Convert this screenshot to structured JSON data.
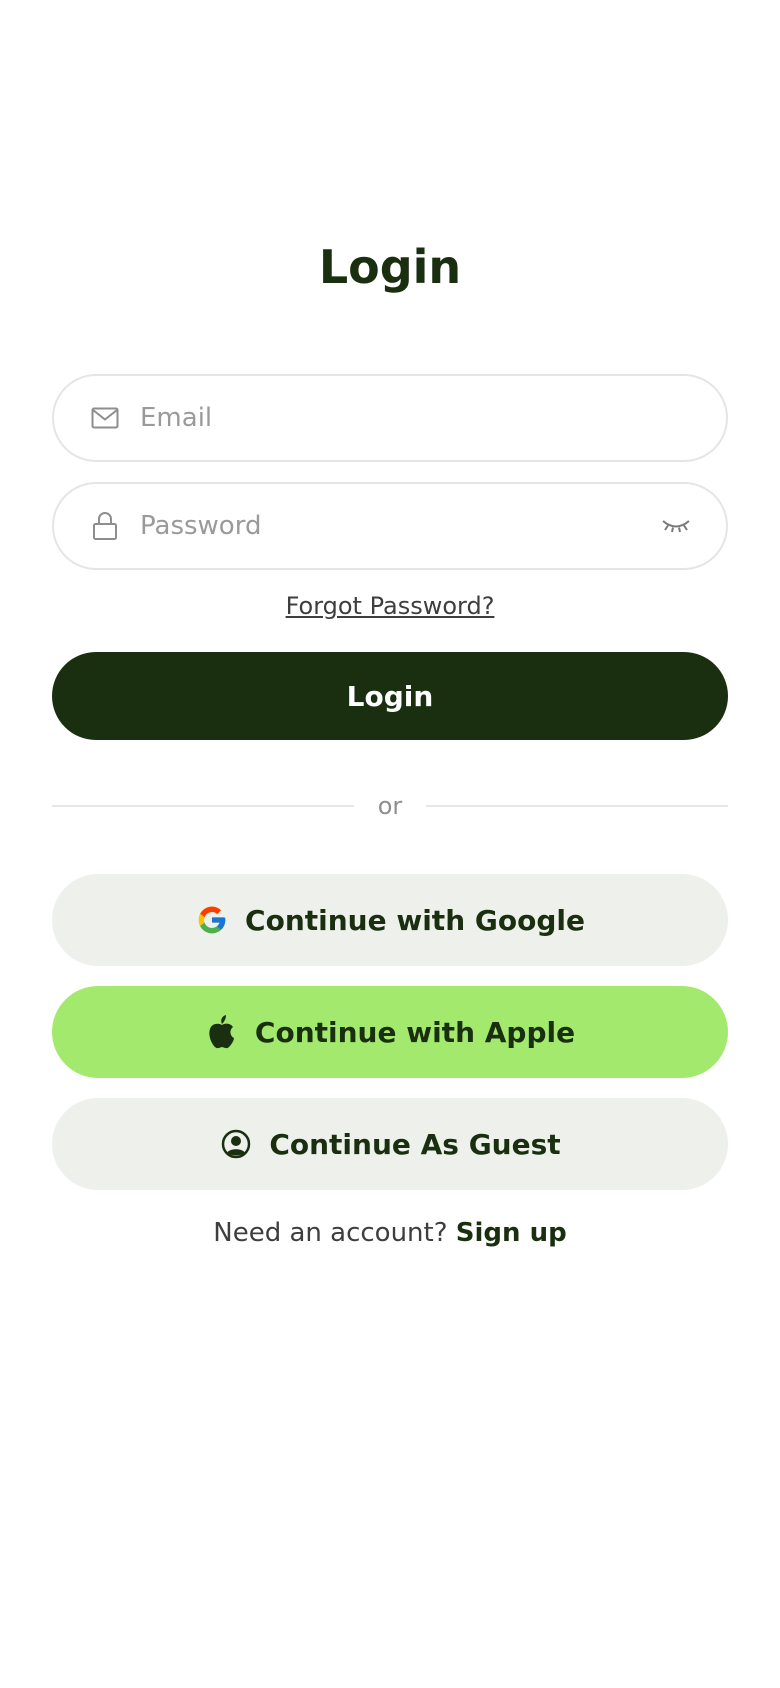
{
  "header": {
    "title": "Login"
  },
  "form": {
    "email": {
      "placeholder": "Email",
      "value": ""
    },
    "password": {
      "placeholder": "Password",
      "value": ""
    },
    "forgot_label": "Forgot Password?",
    "submit_label": "Login"
  },
  "divider": {
    "label": "or"
  },
  "social": {
    "google_label": "Continue with Google",
    "apple_label": "Continue with Apple",
    "guest_label": "Continue As Guest"
  },
  "footer": {
    "prompt": "Need an account?",
    "signup_label": "Sign up"
  },
  "icons": {
    "email": "mail-icon",
    "password": "lock-icon",
    "visibility": "eye-closed-icon",
    "google": "google-icon",
    "apple": "apple-icon",
    "guest": "user-circle-icon"
  },
  "colors": {
    "primary": "#1a2f0f",
    "accent": "#a3e96d",
    "secondary_bg": "#eef0ec",
    "border": "#e4e6e2"
  }
}
